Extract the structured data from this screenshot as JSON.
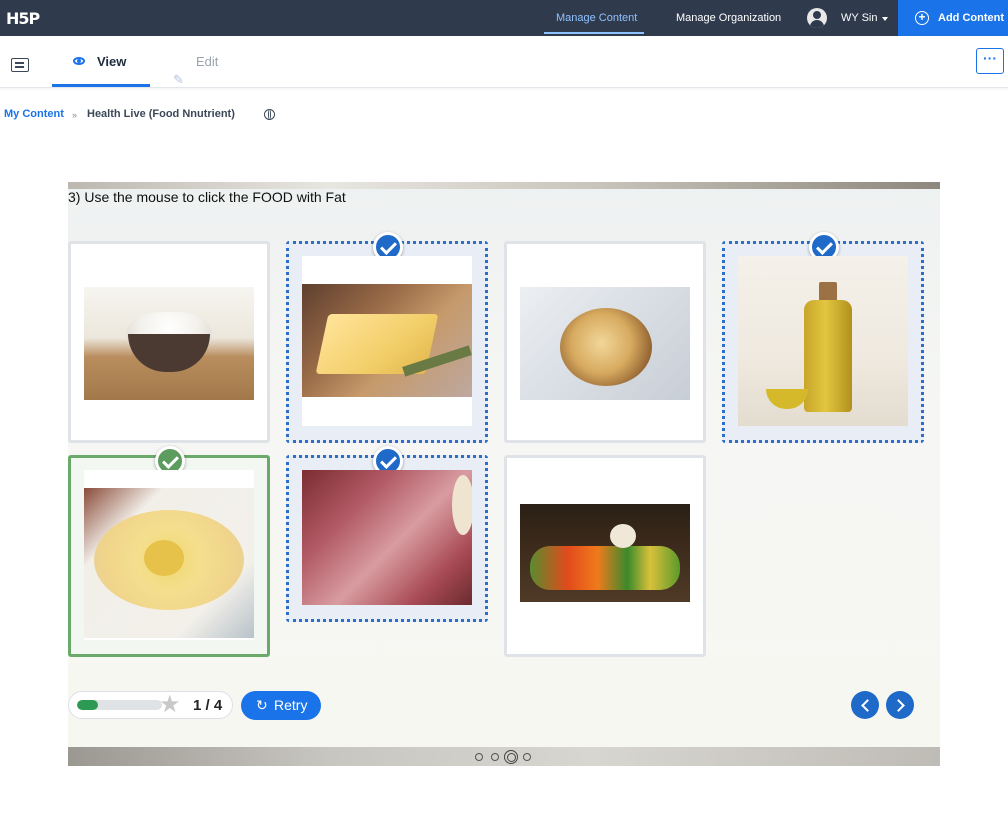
{
  "topbar": {
    "logo": "H5P",
    "nav": [
      "Manage Content",
      "Manage Organization"
    ],
    "user": "WY Sin",
    "add_content": "Add Content"
  },
  "tabs": {
    "view": "View",
    "edit": "Edit",
    "more": "···"
  },
  "breadcrumb": {
    "root": "My Content",
    "sep": "»",
    "title": "Health Live (Food Nnutrient)"
  },
  "question": "3) Use the mouse to click the FOOD with Fat",
  "cards": [
    {
      "name": "rice",
      "state": "unselected"
    },
    {
      "name": "butter",
      "state": "selected"
    },
    {
      "name": "bread",
      "state": "unselected"
    },
    {
      "name": "olive-oil",
      "state": "selected"
    },
    {
      "name": "cheese",
      "state": "correct"
    },
    {
      "name": "meat",
      "state": "selected"
    },
    {
      "name": "vegetables",
      "state": "unselected"
    }
  ],
  "score": {
    "text": "1 / 4",
    "progress": 0.25
  },
  "retry": "Retry",
  "slides": {
    "count": 4,
    "current": 3
  },
  "colors": {
    "accent": "#1a73e8",
    "topbar": "#2f3a4d",
    "correct": "#5c9c5f"
  }
}
